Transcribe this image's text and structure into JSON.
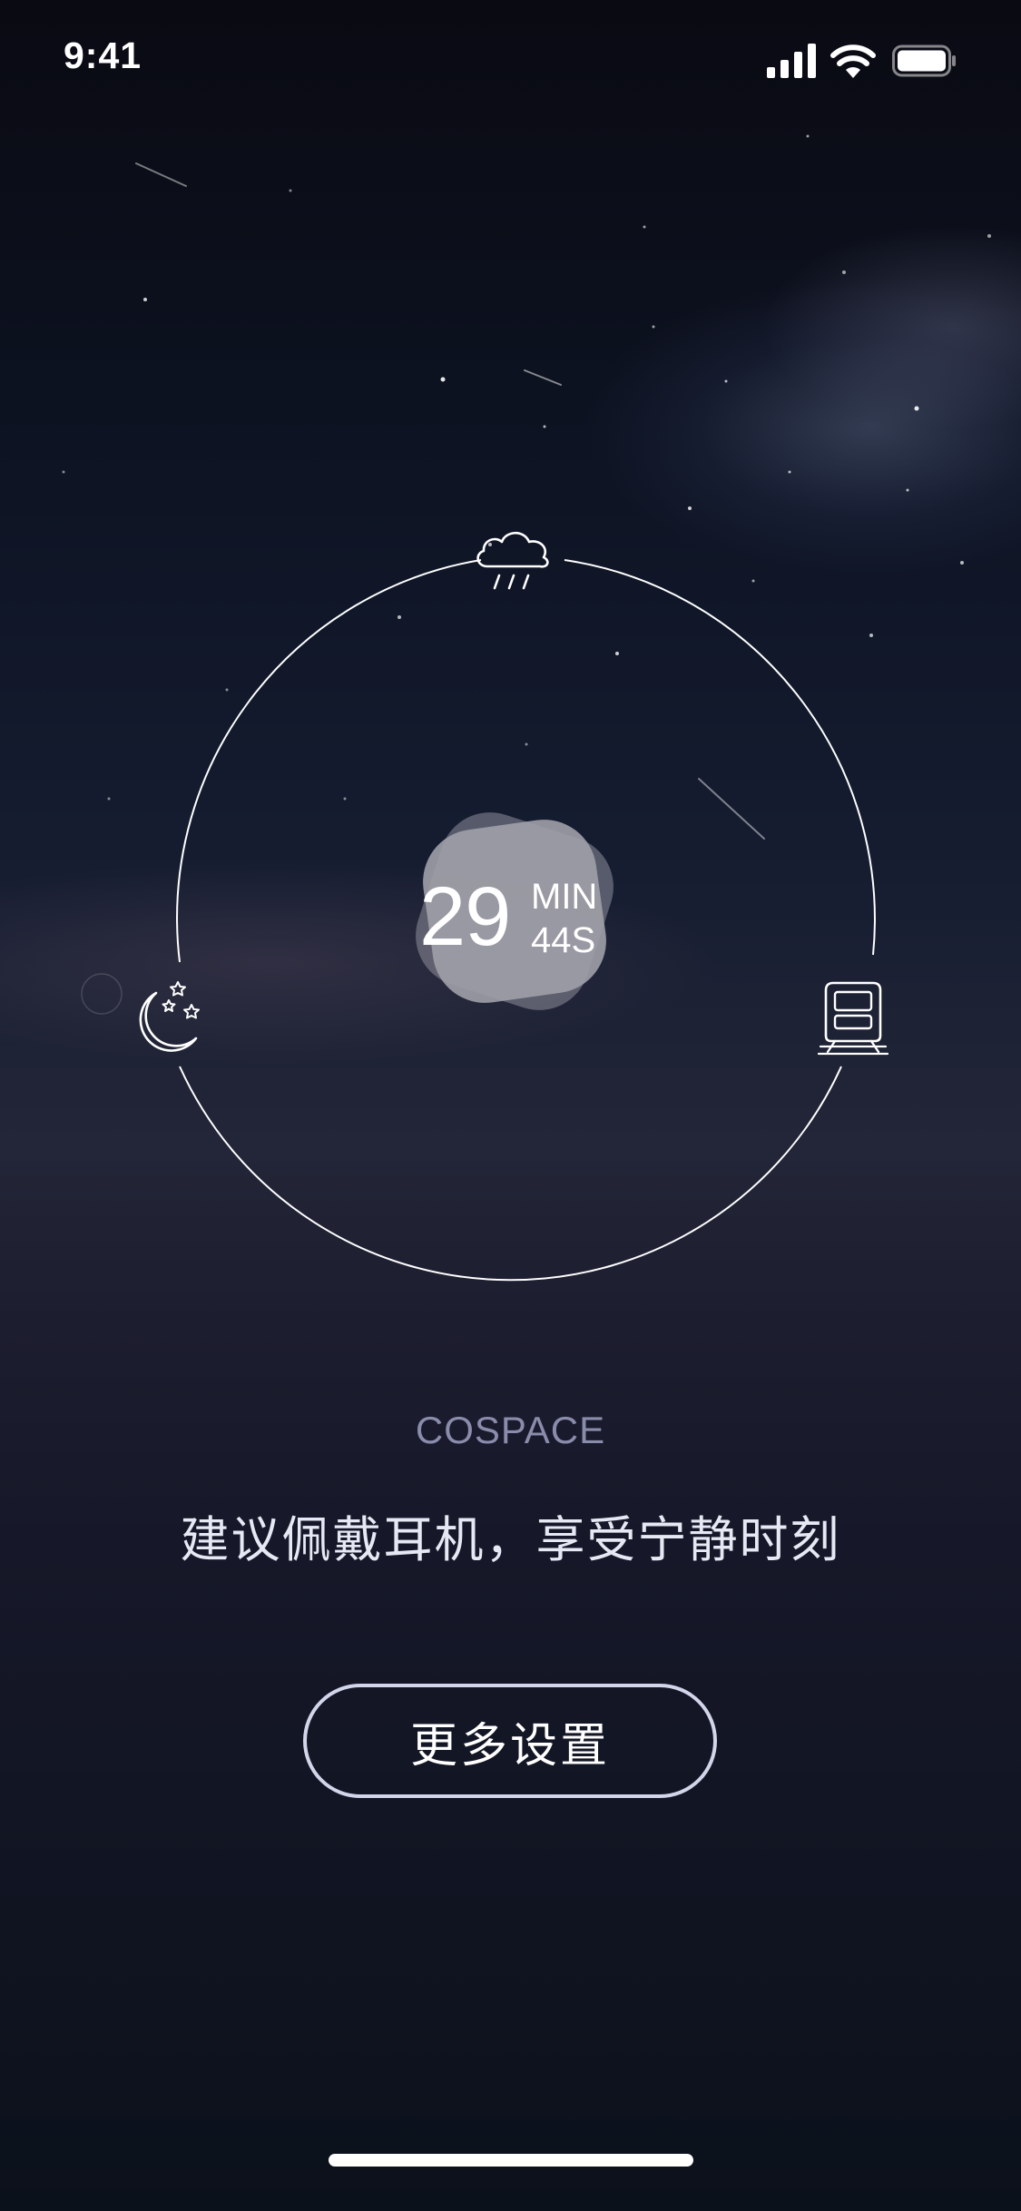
{
  "status_bar": {
    "time": "9:41",
    "icons": [
      "cellular-signal-icon",
      "wifi-icon",
      "battery-icon"
    ]
  },
  "timer": {
    "value": "29",
    "unit": "MIN",
    "seconds": "44S"
  },
  "scenes": {
    "top_icon": "rain-cloud-icon",
    "left_icon": "moon-stars-icon",
    "right_icon": "train-icon"
  },
  "brand": {
    "name": "COSPACE"
  },
  "tagline": "建议佩戴耳机，享受宁静时刻",
  "actions": {
    "more_settings_label": "更多设置"
  },
  "colors": {
    "ring": "#ffffff",
    "timer_box": "#9a9aa2",
    "brand_text": "#8a8cab",
    "button_border": "#d3d6ea"
  }
}
